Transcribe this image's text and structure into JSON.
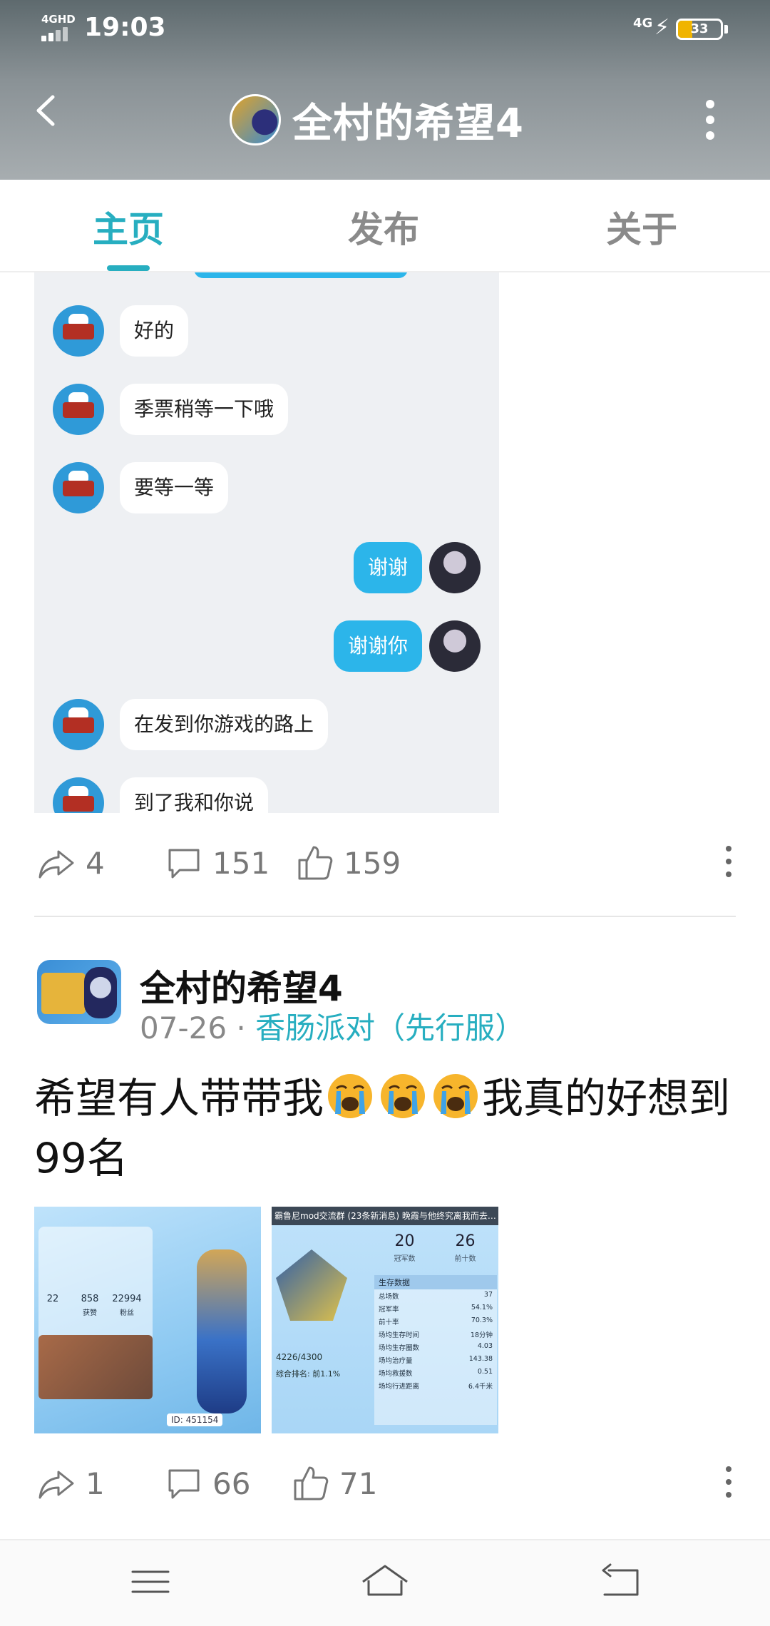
{
  "status_bar": {
    "network_left": "4GHD",
    "time": "19:03",
    "network_right": "4G",
    "battery_level": "33",
    "battery_fraction": 0.33,
    "battery_color": "#f0b400"
  },
  "header": {
    "title": "全村的希望4",
    "back_icon": "chevron-left-icon",
    "more_icon": "more-vertical-icon"
  },
  "tabs": [
    {
      "label": "主页",
      "active": true
    },
    {
      "label": "发布",
      "active": false
    },
    {
      "label": "关于",
      "active": false
    }
  ],
  "accent_color": "#27aec0",
  "post1": {
    "chat_messages": [
      {
        "side": "in",
        "text": "好的"
      },
      {
        "side": "in",
        "text": "季票稍等一下哦"
      },
      {
        "side": "in",
        "text": "要等一等"
      },
      {
        "side": "out",
        "text": "谢谢"
      },
      {
        "side": "out",
        "text": "谢谢你"
      },
      {
        "side": "in",
        "text": "在发到你游戏的路上"
      },
      {
        "side": "in",
        "text": "到了我和你说"
      }
    ],
    "shares": "4",
    "comments": "151",
    "likes": "159"
  },
  "post2": {
    "author": "全村的希望4",
    "date": "07-26",
    "separator": "·",
    "topic": "香肠派对（先行服）",
    "text_before_emoji": "希望有人带带我",
    "emoji": "loudly-crying-face",
    "emoji_count": 3,
    "text_after_emoji": "我真的好想到99名",
    "image1": {
      "stats": [
        "22",
        "858",
        "22994"
      ],
      "stat_labels": [
        "",
        "获赞",
        "粉丝"
      ],
      "id_text": "ID: 451154"
    },
    "image2": {
      "header": "霸鲁尼mod交流群 (23条新消息) 晚霞与他终究离我而去…",
      "big_nums": [
        "20",
        "26"
      ],
      "big_num_labels": [
        "冠军数",
        "前十数"
      ],
      "score": "4226/4300",
      "rank_text": "综合排名: 前1.1%",
      "table_title": "生存数据",
      "table_rows": [
        {
          "label": "总场数",
          "value": "37"
        },
        {
          "label": "冠军率",
          "value": "54.1%"
        },
        {
          "label": "前十率",
          "value": "70.3%"
        },
        {
          "label": "场均生存时间",
          "value": "18分钟"
        },
        {
          "label": "场均生存圈数",
          "value": "4.03"
        },
        {
          "label": "场均治疗量",
          "value": "143.38"
        },
        {
          "label": "场均救援数",
          "value": "0.51"
        },
        {
          "label": "场均行进距离",
          "value": "6.4千米"
        }
      ]
    },
    "shares": "1",
    "comments": "66",
    "likes": "71"
  },
  "bottom_nav": [
    {
      "icon": "menu-icon"
    },
    {
      "icon": "home-icon"
    },
    {
      "icon": "back-icon"
    }
  ]
}
